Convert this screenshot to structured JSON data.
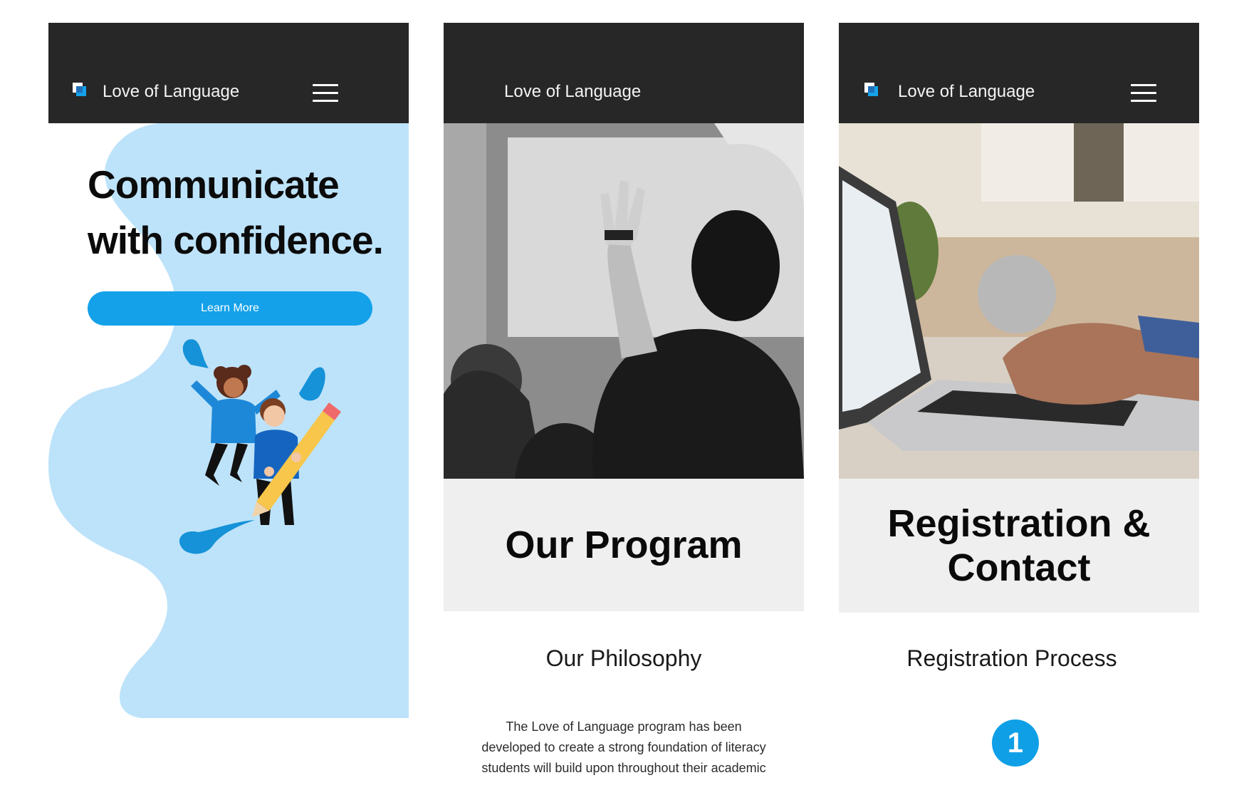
{
  "brand": {
    "name": "Love of Language",
    "logo_icon": "logo-square-icon",
    "menu_icon": "hamburger-menu-icon"
  },
  "colors": {
    "accent": "#14a1ea",
    "header": "#272727",
    "hero_blob": "#bde3fa",
    "panel": "#efefef"
  },
  "home": {
    "headline_line1": "Communicate",
    "headline_line2": "with confidence.",
    "cta_label": "Learn More",
    "illustration": "kids-with-pencil-illustration"
  },
  "program": {
    "photo": "student-raising-hand-photo",
    "heading": "Our Program",
    "section_title": "Our Philosophy",
    "body_line1": "The Love of Language program has been",
    "body_line2": "developed to create a strong foundation of literacy",
    "body_line3": "students will build upon throughout their academic"
  },
  "registration": {
    "photo": "laptop-typing-photo",
    "heading_line1": "Registration &",
    "heading_line2": "Contact",
    "section_title": "Registration Process",
    "step_number": "1"
  }
}
